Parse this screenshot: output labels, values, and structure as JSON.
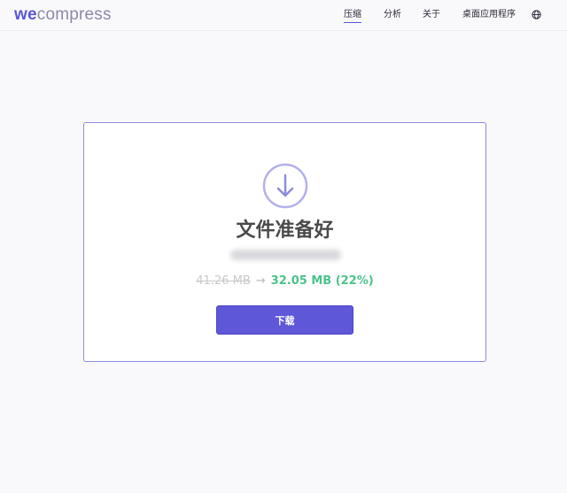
{
  "header": {
    "logo_primary": "we",
    "logo_secondary": "compress",
    "nav": [
      {
        "label": "压缩",
        "active": true
      },
      {
        "label": "分析",
        "active": false
      },
      {
        "label": "关于",
        "active": false
      },
      {
        "label": "桌面应用程序",
        "active": false
      }
    ],
    "language_icon": "globe-icon"
  },
  "card": {
    "icon": "download-circle-icon",
    "title": "文件准备好",
    "filename": "",
    "original_size": "41.26 MB",
    "arrow": "→",
    "compressed_size": "32.05 MB (22%)",
    "download_label": "下载"
  },
  "colors": {
    "accent": "#5e58d8",
    "success": "#4cc38a",
    "muted": "#c9c9cf",
    "card_border": "#8f8be0"
  }
}
